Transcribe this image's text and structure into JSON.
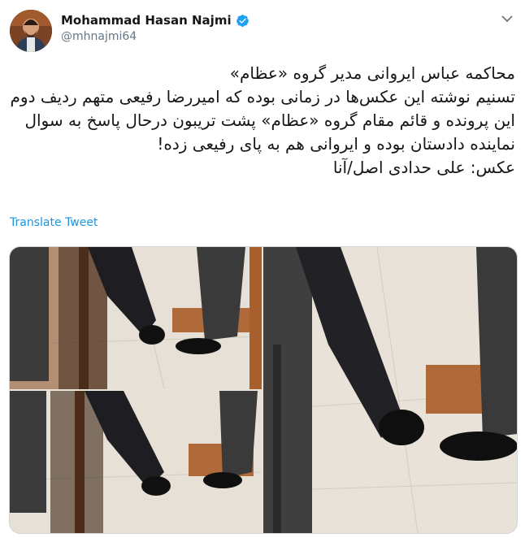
{
  "author": {
    "name": "Mohammad Hasan Najmi",
    "handle": "@mhnajmi64",
    "verified": true,
    "avatar_icon": "profile-photo",
    "verified_icon": "verified-badge-icon",
    "verified_color": "#1da1f2"
  },
  "tweet": {
    "lines": [
      "محاکمه عباس ایروانی مدیر گروه «عظام»",
      "تسنیم نوشته این عکس‌ها در زمانی بوده که امیررضا رفیعی متهم ردیف دوم",
      "این پرونده و  قائم مقام گروه «عظام» پشت تریبون درحال پاسخ به سوال",
      "نماینده دادستان بوده و ایروانی هم به پای رفیعی زده!",
      "عکس: علی حدادی اصل/آنا"
    ],
    "translate_label": "Translate Tweet"
  },
  "menu": {
    "icon": "chevron-down-icon"
  },
  "colors": {
    "link": "#1b95e0",
    "handle": "#657786",
    "border": "#ccd6dd"
  }
}
